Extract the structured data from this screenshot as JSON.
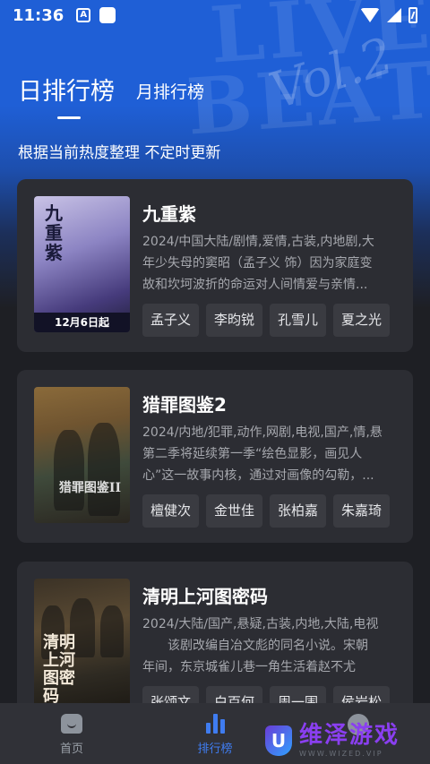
{
  "status_bar": {
    "time": "11:36",
    "a_badge": "A"
  },
  "tabs": {
    "day": "日排行榜",
    "month": "月排行榜"
  },
  "subtitle": "根据当前热度整理 不定时更新",
  "items": [
    {
      "title": "九重紫",
      "meta": "2024/中国大陆/剧情,爱情,古装,内地剧,大",
      "desc1": "年少失母的窦昭（孟子义 饰）因为家庭变",
      "desc2": "故和坎坷波折的命运对人间情爱与亲情...",
      "poster_title": "九重紫",
      "poster_date": "12月6日起",
      "cast": [
        "孟子义",
        "李昀锐",
        "孔雪儿",
        "夏之光"
      ]
    },
    {
      "title": "猎罪图鉴2",
      "meta": "2024/内地/犯罪,动作,网剧,电视,国产,情,悬",
      "desc1": "第二季将延续第一季“绘色显影，画见人",
      "desc2": "心”这一故事内核，通过对画像的勾勒，...",
      "poster_title": "猎罪图鉴II",
      "cast": [
        "檀健次",
        "金世佳",
        "张柏嘉",
        "朱嘉琦"
      ]
    },
    {
      "title": "清明上河图密码",
      "meta": "2024/大陆/国产,悬疑,古装,内地,大陆,电视",
      "desc1": "　　该剧改编自冶文彪的同名小说。宋朝",
      "desc2": "年间，东京城雀儿巷一角生活着赵不尤",
      "poster_title": "清明上河图密码",
      "cast": [
        "张颂文",
        "白百何",
        "周一围",
        "侯岩松"
      ]
    }
  ],
  "nav": {
    "home": "首页",
    "rank": "排行榜"
  },
  "brand": {
    "logo": "U",
    "name": "维泽游戏",
    "url": "WWW.WIZED.VIP"
  },
  "colors": {
    "accent": "#3f7cf0",
    "hero": "#1f5fd6",
    "background": "#1e1f24",
    "card": "#2c2d33"
  }
}
